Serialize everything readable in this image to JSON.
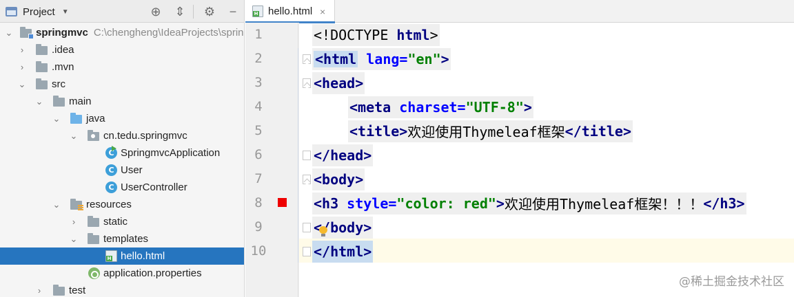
{
  "project_panel": {
    "title": "Project",
    "tree": [
      {
        "label": "springmvc",
        "path": "C:\\chengheng\\IdeaProjects\\springmvc"
      },
      {
        "label": ".idea"
      },
      {
        "label": ".mvn"
      },
      {
        "label": "src"
      },
      {
        "label": "main"
      },
      {
        "label": "java"
      },
      {
        "label": "cn.tedu.springmvc"
      },
      {
        "label": "SpringmvcApplication"
      },
      {
        "label": "User"
      },
      {
        "label": "UserController"
      },
      {
        "label": "resources"
      },
      {
        "label": "static"
      },
      {
        "label": "templates"
      },
      {
        "label": "hello.html"
      },
      {
        "label": "application.properties"
      },
      {
        "label": "test"
      }
    ]
  },
  "editor": {
    "tab_label": "hello.html",
    "line_numbers": [
      "1",
      "2",
      "3",
      "4",
      "5",
      "6",
      "7",
      "8",
      "9",
      "10"
    ],
    "code": {
      "l1_a": "<!DOCTYPE ",
      "l1_b": "html",
      "l1_c": ">",
      "l2_tag": "<html",
      "l2_attr": " lang=",
      "l2_val": "\"en\"",
      "l2_end": ">",
      "l3": "<head>",
      "l4_tag": "<meta",
      "l4_attr": " charset=",
      "l4_val": "\"UTF-8\"",
      "l4_end": ">",
      "l5_open": "<title>",
      "l5_text": "欢迎使用Thymeleaf框架",
      "l5_close": "</title>",
      "l6": "</head>",
      "l7": "<body>",
      "l8_tag": "<h3",
      "l8_attr": " style=",
      "l8_val": "\"color: red\"",
      "l8_end": ">",
      "l8_text": "欢迎使用Thymeleaf框架！！！",
      "l8_close": "</h3>",
      "l9": "</body>",
      "l10": "</html>"
    },
    "watermark": "@稀土掘金技术社区"
  },
  "colors": {
    "selection": "#2675bf",
    "tag": "#000080",
    "attribute": "#0000ff",
    "value": "#008000",
    "breakpoint": "#ee0000"
  }
}
